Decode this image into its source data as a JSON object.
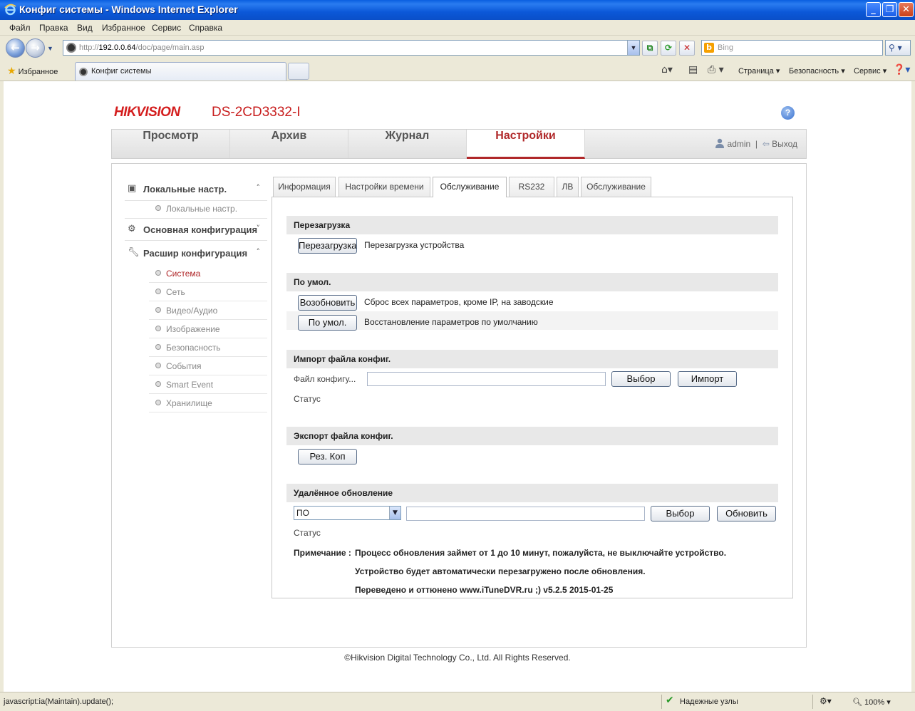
{
  "browser": {
    "title": "Конфиг системы - Windows Internet Explorer",
    "menu": [
      "Файл",
      "Правка",
      "Вид",
      "Избранное",
      "Сервис",
      "Справка"
    ],
    "address_prefix": "http://",
    "address_host": "192.0.0.64",
    "address_path": "/doc/page/main.asp",
    "search_placeholder": "Bing",
    "favorites_label": "Избранное",
    "tab_label": "Конфиг системы",
    "commands": {
      "page": "Страница",
      "security": "Безопасность",
      "tools": "Сервис"
    },
    "status_text": "javascript:ia(Maintain).update();",
    "status_zone": "Надежные узлы",
    "zoom": "100%"
  },
  "header": {
    "logo": "HIKVISION",
    "model": "DS-2CD3332-I",
    "help": "?"
  },
  "nav": {
    "items": [
      "Просмотр",
      "Архив",
      "Журнал",
      "Настройки"
    ],
    "active": "Настройки",
    "user": "admin",
    "separator": "|",
    "logout": "Выход"
  },
  "sidebar": {
    "local": {
      "label": "Локальные настр.",
      "sub": "Локальные настр."
    },
    "basic": {
      "label": "Основная конфигурация"
    },
    "advanced": {
      "label": "Расшир конфигурация",
      "items": [
        "Система",
        "Сеть",
        "Видео/Аудио",
        "Изображение",
        "Безопасность",
        "События",
        "Smart Event",
        "Хранилище"
      ],
      "active": "Система"
    }
  },
  "tabs": [
    "Информация",
    "Настройки времени",
    "Обслуживание",
    "RS232",
    "ЛВ",
    "Обслуживание"
  ],
  "active_tab_index": 2,
  "maintenance": {
    "reboot": {
      "title": "Перезагрузка",
      "button": "Перезагрузка",
      "desc": "Перезагрузка устройства"
    },
    "defaults": {
      "title": "По умол.",
      "restore_button": "Возобновить",
      "restore_desc": "Сброс всех параметров, кроме IP, на заводские",
      "default_button": "По умол.",
      "default_desc": "Восстановление параметров по умолчанию"
    },
    "import": {
      "title": "Импорт файла конфиг.",
      "file_label": "Файл конфигу...",
      "file_value": "",
      "browse": "Выбор",
      "import": "Импорт",
      "status_label": "Статус"
    },
    "export": {
      "title": "Экспорт файла конфиг.",
      "button": "Рез. Коп"
    },
    "upgrade": {
      "title": "Удалённое обновление",
      "type_selected": "ПО",
      "file_value": "",
      "browse": "Выбор",
      "upgrade": "Обновить",
      "status_label": "Статус",
      "note_label": "Примечание :",
      "note_lines": [
        "Процесс обновления займет от 1 до 10 минут, пожалуйста, не выключайте устройство.",
        "Устройство будет автоматически перезагружено после обновления.",
        "Переведено и оттюнено www.iTuneDVR.ru ;) v5.2.5 2015-01-25"
      ]
    }
  },
  "footer": "©Hikvision Digital Technology Co., Ltd. All Rights Reserved.",
  "colors": {
    "accent": "#b0282a",
    "logo": "#d41e1e",
    "titlebar": "#0a5ee0"
  }
}
